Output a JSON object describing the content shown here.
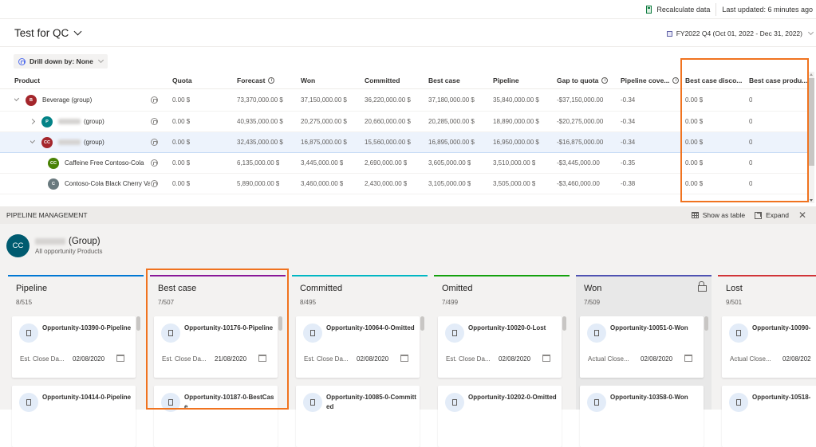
{
  "topbar": {
    "recalculate_label": "Recalculate data",
    "last_updated": "Last updated: 6 minutes ago"
  },
  "header": {
    "title": "Test for QC",
    "period": "FY2022 Q4 (Oct 01, 2022 - Dec 31, 2022)"
  },
  "drilldown": {
    "label": "Drill down by: None"
  },
  "grid": {
    "columns": [
      "Product",
      "Quota",
      "Forecast",
      "Won",
      "Committed",
      "Best case",
      "Pipeline",
      "Gap to quota",
      "Pipeline cove...",
      "Best case disco...",
      "Best case produ..."
    ],
    "rows": [
      {
        "name": "Beverage (group)",
        "initials": "B",
        "avatar_color": "#a4262c",
        "expand": "expanded",
        "quota": "0.00 $",
        "forecast": "73,370,000.00 $",
        "won": "37,150,000.00 $",
        "committed": "36,220,000.00 $",
        "best_case": "37,180,000.00 $",
        "pipeline": "35,840,000.00 $",
        "gap": "-$37,150,000.00",
        "coverage": "-0.34",
        "bc_disco": "0.00 $",
        "bc_produ": "0"
      },
      {
        "name": "(group)",
        "initials": "P",
        "avatar_color": "#038387",
        "expand": "collapsed",
        "quota": "0.00 $",
        "forecast": "40,935,000.00 $",
        "won": "20,275,000.00 $",
        "committed": "20,660,000.00 $",
        "best_case": "20,285,000.00 $",
        "pipeline": "18,890,000.00 $",
        "gap": "-$20,275,000.00",
        "coverage": "-0.34",
        "bc_disco": "0.00 $",
        "bc_produ": "0"
      },
      {
        "name": "(group)",
        "initials": "CC",
        "avatar_color": "#a4262c",
        "expand": "expanded",
        "quota": "0.00 $",
        "forecast": "32,435,000.00 $",
        "won": "16,875,000.00 $",
        "committed": "15,560,000.00 $",
        "best_case": "16,895,000.00 $",
        "pipeline": "16,950,000.00 $",
        "gap": "-$16,875,000.00",
        "coverage": "-0.34",
        "bc_disco": "0.00 $",
        "bc_produ": "0"
      },
      {
        "name": "Caffeine Free Contoso-Cola",
        "initials": "CC",
        "avatar_color": "#498205",
        "expand": "none",
        "quota": "0.00 $",
        "forecast": "6,135,000.00 $",
        "won": "3,445,000.00 $",
        "committed": "2,690,000.00 $",
        "best_case": "3,605,000.00 $",
        "pipeline": "3,510,000.00 $",
        "gap": "-$3,445,000.00",
        "coverage": "-0.35",
        "bc_disco": "0.00 $",
        "bc_produ": "0"
      },
      {
        "name": "Contoso-Cola Black Cherry Va",
        "initials": "C",
        "avatar_color": "#69797e",
        "expand": "none",
        "quota": "0.00 $",
        "forecast": "5,890,000.00 $",
        "won": "3,460,000.00 $",
        "committed": "2,430,000.00 $",
        "best_case": "3,105,000.00 $",
        "pipeline": "3,505,000.00 $",
        "gap": "-$3,460,000.00",
        "coverage": "-0.38",
        "bc_disco": "0.00 $",
        "bc_produ": "0"
      }
    ]
  },
  "pipeline_management": {
    "title": "PIPELINE MANAGEMENT",
    "show_as_table": "Show as table",
    "expand": "Expand",
    "group_initials": "CC",
    "group_name": "(Group)",
    "group_sub": "All opportunity Products",
    "columns": [
      {
        "title": "Pipeline",
        "count": "8/515",
        "color": "#0078d4",
        "locked": false,
        "cards": [
          {
            "name": "Opportunity-10390-0-Pipeline",
            "date_label": "Est. Close Da...",
            "date": "02/08/2020"
          },
          {
            "name": "Opportunity-10414-0-Pipeline"
          }
        ]
      },
      {
        "title": "Best case",
        "count": "7/507",
        "color": "#881798",
        "locked": false,
        "cards": [
          {
            "name": "Opportunity-10176-0-Pipeline",
            "date_label": "Est. Close Da...",
            "date": "21/08/2020"
          },
          {
            "name": "Opportunity-10187-0-BestCase"
          }
        ]
      },
      {
        "title": "Committed",
        "count": "8/495",
        "color": "#00b7c3",
        "locked": false,
        "cards": [
          {
            "name": "Opportunity-10064-0-Omitted",
            "date_label": "Est. Close Da...",
            "date": "02/08/2020"
          },
          {
            "name": "Opportunity-10085-0-Committed"
          }
        ]
      },
      {
        "title": "Omitted",
        "count": "7/499",
        "color": "#13a10e",
        "locked": false,
        "cards": [
          {
            "name": "Opportunity-10020-0-Lost",
            "date_label": "Est. Close Da...",
            "date": "02/08/2020"
          },
          {
            "name": "Opportunity-10202-0-Omitted"
          }
        ]
      },
      {
        "title": "Won",
        "count": "7/509",
        "color": "#4f52b2",
        "locked": true,
        "cards": [
          {
            "name": "Opportunity-10051-0-Won",
            "date_label": "Actual Close...",
            "date": "02/08/2020"
          },
          {
            "name": "Opportunity-10358-0-Won"
          }
        ]
      },
      {
        "title": "Lost",
        "count": "9/501",
        "color": "#d13438",
        "locked": false,
        "cards": [
          {
            "name": "Opportunity-10090-",
            "date_label": "Actual Close...",
            "date": "02/08/202"
          },
          {
            "name": "Opportunity-10518-"
          }
        ]
      }
    ]
  }
}
